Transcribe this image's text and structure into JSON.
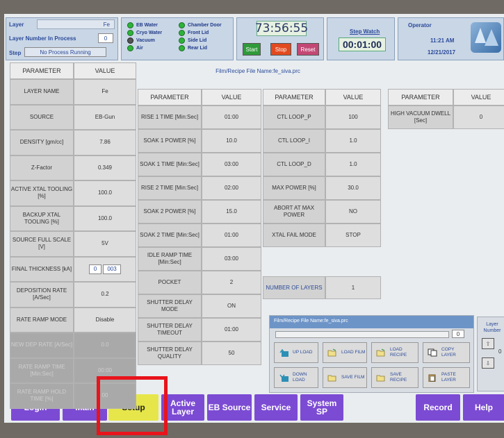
{
  "status": {
    "layer_label": "Layer",
    "layer_value": "Fe",
    "layer_number_label": "Layer Number In Process",
    "layer_number_value": "0",
    "step_label": "Step",
    "step_value": "No Process Running"
  },
  "indicators": {
    "col1": [
      "EB Water",
      "Cryo Water",
      "Vacuum",
      "Air"
    ],
    "col2": [
      "Chamber Door",
      "Front Lid",
      "Side Lid",
      "Rear Lid"
    ]
  },
  "timer": {
    "value": "73:56:55",
    "start": "Start",
    "stop": "Stop",
    "reset": "Reset"
  },
  "stopwatch": {
    "label": "Step Watch",
    "value": "00:01:00"
  },
  "operator": {
    "label": "Operator",
    "time": "11:21 AM",
    "date": "12/21/2017"
  },
  "file_title": "Film/Recipe File Name:fe_siva.prc",
  "headers": {
    "parameter": "PARAMETER",
    "value": "VALUE"
  },
  "table1": [
    {
      "p": "LAYER NAME",
      "v": "Fe"
    },
    {
      "p": "SOURCE",
      "v": "EB-Gun"
    },
    {
      "p": "DENSITY [gm/cc]",
      "v": "7.86"
    },
    {
      "p": "Z-Factor",
      "v": "0.349"
    },
    {
      "p": "ACTIVE XTAL TOOLING [%]",
      "v": "100.0"
    },
    {
      "p": "BACKUP XTAL TOOLING [%]",
      "v": "100.0"
    },
    {
      "p": "SOURCE FULL SCALE [V]",
      "v": "5V"
    },
    {
      "p": "FINAL THICKNESS [kA]",
      "v": "",
      "in1": "0",
      "in2": "003"
    },
    {
      "p": "DEPOSITION RATE [A/Sec]",
      "v": "0.2"
    },
    {
      "p": "RATE RAMP MODE",
      "v": "Disable"
    },
    {
      "p": "NEW DEP RATE [A/Sec]",
      "v": "0.0"
    },
    {
      "p": "RATE RAMP TIME [Min:Sec]",
      "v": "00:00"
    },
    {
      "p": "RATE RAMP HOLD TIME [%]",
      "v": "00"
    }
  ],
  "table2": [
    {
      "p": "RISE 1 TIME [Min:Sec]",
      "v": "01:00"
    },
    {
      "p": "SOAK 1 POWER [%]",
      "v": "10.0"
    },
    {
      "p": "SOAK 1 TIME [Min:Sec]",
      "v": "03:00"
    },
    {
      "p": "RISE 2 TIME [Min:Sec]",
      "v": "02:00"
    },
    {
      "p": "SOAK 2 POWER [%]",
      "v": "15.0"
    },
    {
      "p": "SOAK 2 TIME [Min:Sec]",
      "v": "01:00"
    },
    {
      "p": "IDLE RAMP TIME [Min:Sec]",
      "v": "03:00"
    },
    {
      "p": "POCKET",
      "v": "2"
    },
    {
      "p": "SHUTTER DELAY MODE",
      "v": "ON"
    },
    {
      "p": "SHUTTER DELAY TIMEOUT",
      "v": "01:00"
    },
    {
      "p": "SHUTTER DELAY QUALITY",
      "v": "50"
    }
  ],
  "table3": [
    {
      "p": "CTL LOOP_P",
      "v": "100"
    },
    {
      "p": "CTL LOOP_I",
      "v": "1.0"
    },
    {
      "p": "CTL LOOP_D",
      "v": "1.0"
    },
    {
      "p": "MAX POWER [%]",
      "v": "30.0"
    },
    {
      "p": "ABORT AT MAX POWER",
      "v": "NO"
    },
    {
      "p": "XTAL FAIL MODE",
      "v": "STOP"
    }
  ],
  "layers": {
    "p": "NUMBER OF LAYERS",
    "v": "1"
  },
  "table4": [
    {
      "p": "HIGH VACUUM DWELL [Sec]",
      "v": "0"
    }
  ],
  "file_panel": {
    "title": "Film/Recipe File Name:fe_siva.prc",
    "counter": "0",
    "buttons": [
      "UP LOAD",
      "LOAD FILM",
      "LOAD RECIPE",
      "COPY LAYER",
      "DOWN LOAD",
      "SAVE FILM",
      "SAVE RECIPE",
      "PASTE LAYER"
    ]
  },
  "layer_number_panel": {
    "label": "Layer Number",
    "value": "0"
  },
  "nav": [
    "Login",
    "Main",
    "Setup",
    "Active Layer",
    "EB Source",
    "Service",
    "System SP",
    "Record",
    "Help"
  ],
  "colors": {
    "nav": "#7c4bd3",
    "setup": "#e6e64a",
    "highlight": "#e8141b",
    "led_on": "#2db33a"
  }
}
